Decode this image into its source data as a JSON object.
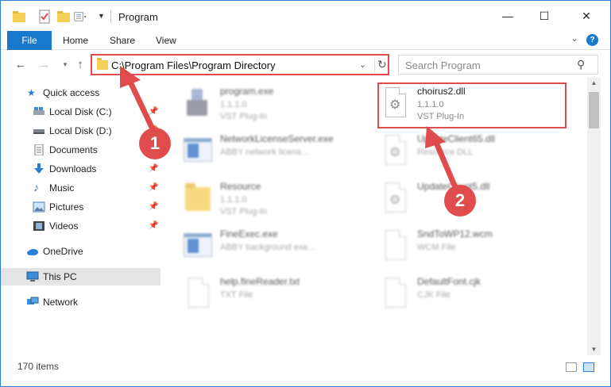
{
  "window": {
    "title": "Program",
    "minimize_glyph": "—",
    "maximize_glyph": "☐",
    "close_glyph": "✕"
  },
  "ribbon": {
    "tabs": [
      {
        "label": "File",
        "active": true
      },
      {
        "label": "Home"
      },
      {
        "label": "Share"
      },
      {
        "label": "View"
      }
    ],
    "help_label": "?"
  },
  "address_bar": {
    "path": "C:\\Program Files\\Program Directory",
    "search_placeholder": "Search Program"
  },
  "sidebar": {
    "items": [
      {
        "label": "Quick access",
        "icon": "star-icon",
        "pinned": false
      },
      {
        "label": "Local Disk (C:)",
        "icon": "drive-icon",
        "pinned": true
      },
      {
        "label": "Local Disk (D:)",
        "icon": "drive-icon",
        "pinned": true
      },
      {
        "label": "Documents",
        "icon": "documents-icon",
        "pinned": true
      },
      {
        "label": "Downloads",
        "icon": "download-icon",
        "pinned": true
      },
      {
        "label": "Music",
        "icon": "music-icon",
        "pinned": true
      },
      {
        "label": "Pictures",
        "icon": "pictures-icon",
        "pinned": true
      },
      {
        "label": "Videos",
        "icon": "videos-icon",
        "pinned": true
      },
      {
        "label": "OneDrive",
        "icon": "cloud-icon",
        "pinned": false
      },
      {
        "label": "This PC",
        "icon": "computer-icon",
        "pinned": false,
        "selected": true
      },
      {
        "label": "Network",
        "icon": "network-icon",
        "pinned": false
      }
    ]
  },
  "files": [
    {
      "name": "program.exe",
      "line2": "1.1.1.0",
      "line3": "VST Plug-In",
      "icon": "exe-icon",
      "blurred": true
    },
    {
      "name": "choirus2.dll",
      "line2": "1.1.1.0",
      "line3": "VST Plug-In",
      "icon": "dll-gear-icon",
      "blurred": false,
      "highlighted": true
    },
    {
      "name": "NetworkLicenseServer.exe",
      "line2": "ABBY network licens...",
      "line3": "",
      "icon": "app-window-icon",
      "blurred": true
    },
    {
      "name": "UpdateClient65.dll",
      "line2": "Resource DLL",
      "line3": "",
      "icon": "dll-gear-icon",
      "blurred": true
    },
    {
      "name": "Resource",
      "line2": "1.1.1.0",
      "line3": "VST Plug-In",
      "icon": "folder-icon",
      "blurred": true
    },
    {
      "name": "UpdateClient5.dll",
      "line2": "",
      "line3": "",
      "icon": "dll-gear-icon",
      "blurred": true
    },
    {
      "name": "FineExec.exe",
      "line2": "ABBY background exe...",
      "line3": "",
      "icon": "app-window-icon",
      "blurred": true
    },
    {
      "name": "SndToWP12.wcm",
      "line2": "WCM File",
      "line3": "",
      "icon": "blank-doc-icon",
      "blurred": true
    },
    {
      "name": "help.fineReader.txt",
      "line2": "TXT File",
      "line3": "",
      "icon": "blank-doc-icon",
      "blurred": true
    },
    {
      "name": "DefaultFont.cjk",
      "line2": "CJK File",
      "line3": "",
      "icon": "blank-doc-icon",
      "blurred": true
    }
  ],
  "callouts": [
    {
      "number": "1"
    },
    {
      "number": "2"
    }
  ],
  "status": {
    "item_count": "170 items"
  },
  "colors": {
    "accent": "#1979ca",
    "highlight_red": "#e04b4b",
    "folder_yellow": "#f6cf57"
  }
}
